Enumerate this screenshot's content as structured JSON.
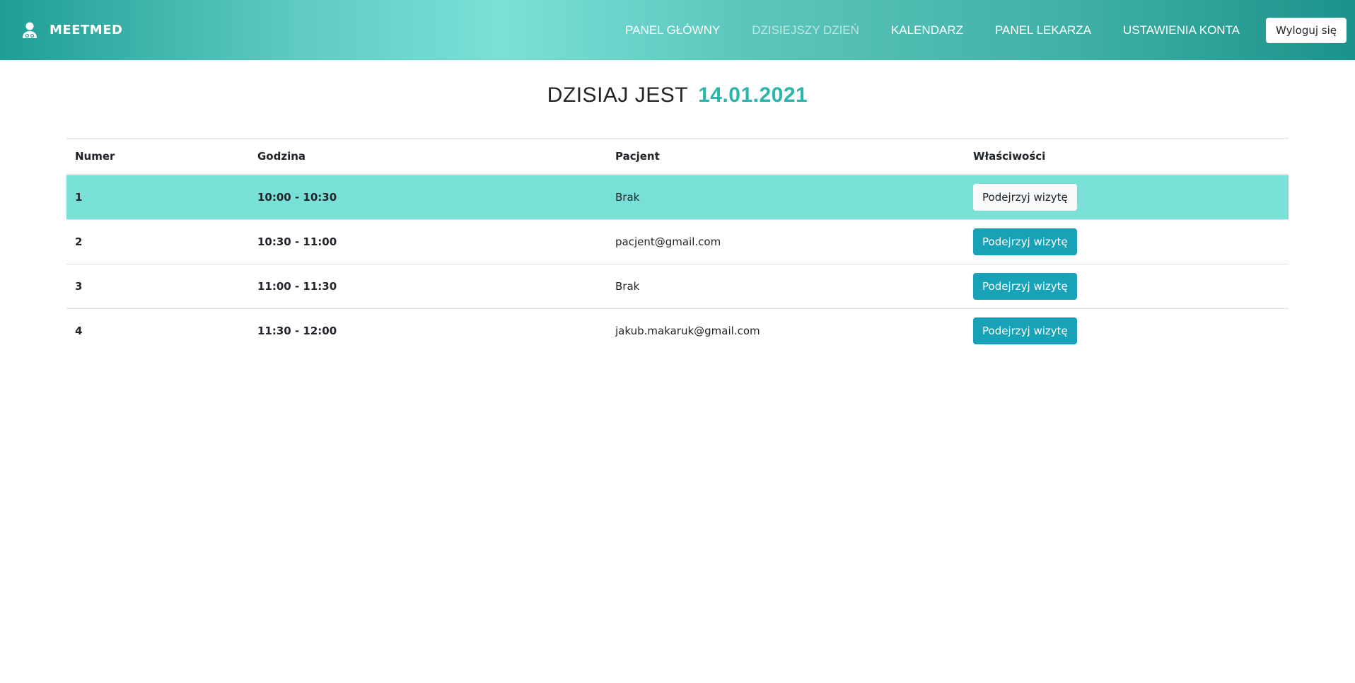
{
  "brand": {
    "name": "MEETMED",
    "icon": "doctor-user-icon"
  },
  "nav": {
    "items": [
      {
        "label": "PANEL GŁÓWNY",
        "active": false
      },
      {
        "label": "DZISIEJSZY DZIEŃ",
        "active": true
      },
      {
        "label": "KALENDARZ",
        "active": false
      },
      {
        "label": "PANEL LEKARZA",
        "active": false
      },
      {
        "label": "USTAWIENIA KONTA",
        "active": false
      }
    ],
    "logout_label": "Wyloguj się"
  },
  "heading": {
    "prefix": "DZISIAJ JEST",
    "date": "14.01.2021"
  },
  "table": {
    "headers": [
      "Numer",
      "Godzina",
      "Pacjent",
      "Właściwości"
    ],
    "rows": [
      {
        "number": "1",
        "time": "10:00 - 10:30",
        "patient": "Brak",
        "action": "Podejrzyj wizytę",
        "highlighted": true
      },
      {
        "number": "2",
        "time": "10:30 - 11:00",
        "patient": "pacjent@gmail.com",
        "action": "Podejrzyj wizytę",
        "highlighted": false
      },
      {
        "number": "3",
        "time": "11:00 - 11:30",
        "patient": "Brak",
        "action": "Podejrzyj wizytę",
        "highlighted": false
      },
      {
        "number": "4",
        "time": "11:30 - 12:00",
        "patient": "jakub.makaruk@gmail.com",
        "action": "Podejrzyj wizytę",
        "highlighted": false
      }
    ]
  },
  "colors": {
    "accent": "#2bb5ab",
    "highlight_row": "#79e0d7",
    "button_info": "#17a2b8"
  }
}
